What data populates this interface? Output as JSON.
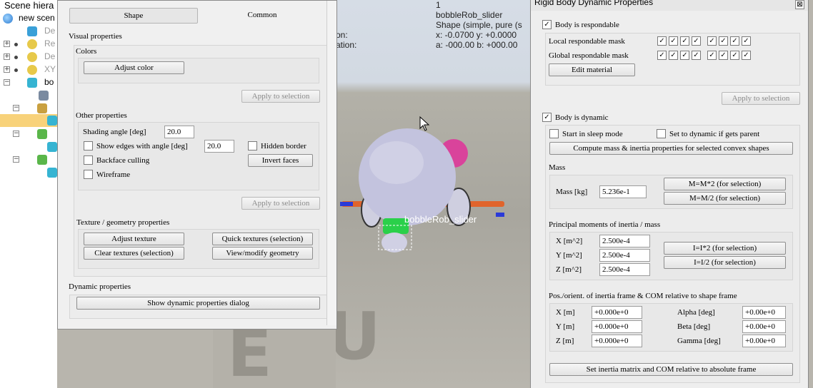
{
  "hierarchy": {
    "title": "Scene hiera",
    "root": "new scen",
    "items": [
      "De",
      "Re",
      "De",
      "XY",
      "bo"
    ]
  },
  "overlay": {
    "id_value": "1",
    "object_name": "bobbleRob_slider",
    "shape_type": "Shape (simple, pure (s",
    "position_label": "on:",
    "orientation_label": "ation:",
    "position_value": "x: -0.0700   y: +0.0000",
    "orientation_value": "a: -000.00   b: +000.00",
    "scene_label": "bobbleRob_slider",
    "watermark": "EDU"
  },
  "shape_dialog": {
    "tabs": [
      "Shape",
      "Common"
    ],
    "visual_properties": "Visual properties",
    "colors": "Colors",
    "adjust_color": "Adjust color",
    "apply_to_selection": "Apply to selection",
    "other_properties": "Other properties",
    "shading_angle_label": "Shading angle [deg]",
    "shading_angle_value": "20.0",
    "show_edges_label": "Show edges with angle [deg]",
    "show_edges_value": "20.0",
    "hidden_border": "Hidden border",
    "backface_culling": "Backface culling",
    "invert_faces": "Invert faces",
    "wireframe": "Wireframe",
    "texture_geometry": "Texture / geometry properties",
    "adjust_texture": "Adjust texture",
    "quick_textures": "Quick textures (selection)",
    "clear_textures": "Clear textures (selection)",
    "view_modify_geometry": "View/modify geometry",
    "dynamic_properties": "Dynamic properties",
    "show_dynamic_dialog": "Show dynamic properties dialog"
  },
  "rigid_dialog": {
    "title": "Rigid Body Dynamic Properties",
    "body_respondable": "Body is respondable",
    "local_mask": "Local respondable mask",
    "global_mask": "Global respondable mask",
    "check_mark": "✓",
    "edit_material": "Edit material",
    "apply_to_selection": "Apply to selection",
    "body_dynamic": "Body is dynamic",
    "start_sleep": "Start in sleep mode",
    "set_dynamic_parent": "Set to dynamic if gets parent",
    "compute_mass": "Compute mass & inertia properties for selected convex shapes",
    "mass_header": "Mass",
    "mass_label": "Mass [kg]",
    "mass_value": "5.236e-1",
    "m_times_2": "M=M*2  (for selection)",
    "m_div_2": "M=M/2  (for selection)",
    "inertia_header": "Principal moments of inertia / mass",
    "ix_label": "X [m^2]",
    "ix_value": "2.500e-4",
    "iy_label": "Y [m^2]",
    "iy_value": "2.500e-4",
    "iz_label": "Z [m^2]",
    "iz_value": "2.500e-4",
    "i_times_2": "I=I*2  (for selection)",
    "i_div_2": "I=I/2  (for selection)",
    "pos_header": "Pos./orient. of inertia frame & COM relative to shape frame",
    "px_label": "X [m]",
    "px_value": "+0.000e+0",
    "py_label": "Y [m]",
    "py_value": "+0.000e+0",
    "pz_label": "Z [m]",
    "pz_value": "+0.000e+0",
    "alpha_label": "Alpha [deg]",
    "alpha_value": "+0.00e+0",
    "beta_label": "Beta [deg]",
    "beta_value": "+0.00e+0",
    "gamma_label": "Gamma [deg]",
    "gamma_value": "+0.00e+0",
    "set_inertia_matrix": "Set inertia matrix and COM relative to absolute frame",
    "close_glyph": "⊠"
  }
}
